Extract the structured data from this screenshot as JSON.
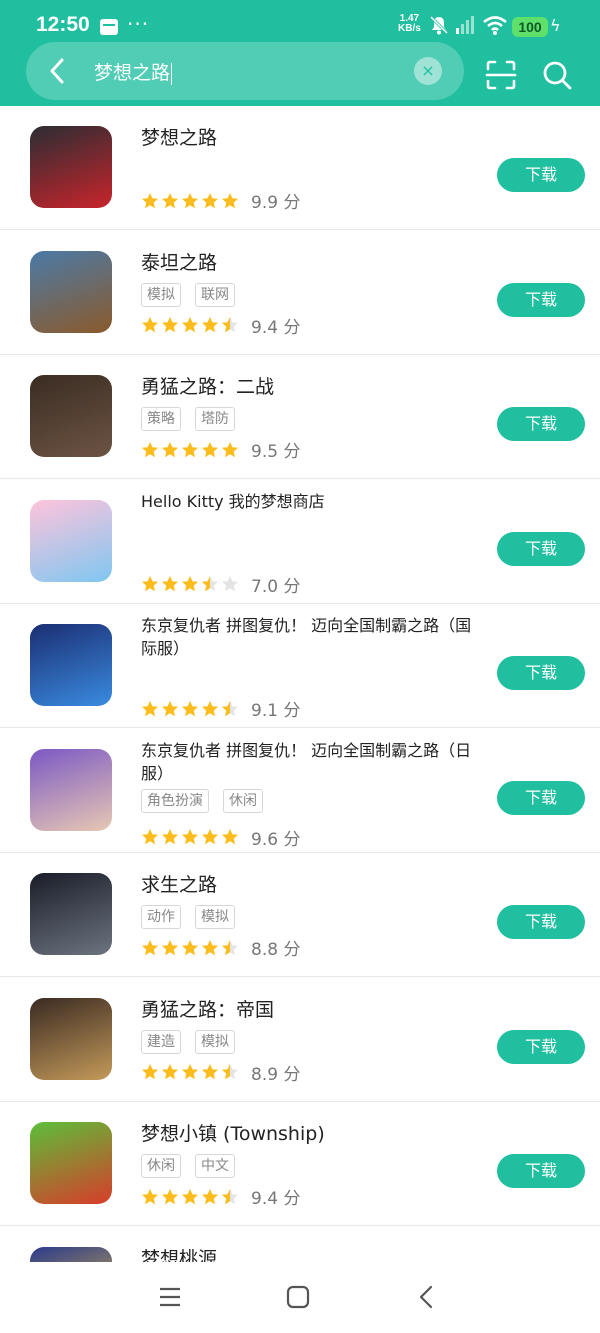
{
  "status_bar": {
    "time": "12:50",
    "dots": "···",
    "net_speed_value": "1.47",
    "net_speed_unit": "KB/s",
    "battery": "100"
  },
  "search": {
    "query": "梦想之路",
    "clear_label": "×"
  },
  "download_label": "下载",
  "score_unit": "分",
  "apps": [
    {
      "title": "梦想之路",
      "tags": [],
      "score": "9.9",
      "stars": 5,
      "icon_name": "dr-racing-icon",
      "icon_colors": [
        "#2a2d33",
        "#c9242b"
      ]
    },
    {
      "title": "泰坦之路",
      "tags": [
        "模拟",
        "联网"
      ],
      "score": "9.4",
      "stars": 4.5,
      "icon_name": "dinosaur-icon",
      "icon_colors": [
        "#4b7aa7",
        "#8b5a2b"
      ]
    },
    {
      "title": "勇猛之路：二战",
      "tags": [
        "策略",
        "塔防"
      ],
      "score": "9.5",
      "stars": 5,
      "icon_name": "soldier-icon",
      "icon_colors": [
        "#3a2c22",
        "#6d5444"
      ]
    },
    {
      "title": "Hello Kitty 我的梦想商店",
      "tags": [],
      "score": "7.0",
      "stars": 3.5,
      "icon_name": "hello-kitty-icon",
      "icon_colors": [
        "#ffc4dc",
        "#7fc6f0"
      ]
    },
    {
      "title": "东京复仇者 拼图复仇！ 迈向全国制霸之路（国际服）",
      "tags": [],
      "score": "9.1",
      "stars": 4.5,
      "icon_name": "tokyo-revengers-icon",
      "icon_colors": [
        "#1b2e72",
        "#3a8be0"
      ]
    },
    {
      "title": "东京复仇者 拼图复仇！ 迈向全国制霸之路（日服）",
      "tags": [
        "角色扮演",
        "休闲"
      ],
      "score": "9.6",
      "stars": 5,
      "icon_name": "tokyo-revengers-jp-icon",
      "icon_colors": [
        "#7b58c4",
        "#e7c8b3"
      ]
    },
    {
      "title": "求生之路",
      "tags": [
        "动作",
        "模拟"
      ],
      "score": "8.8",
      "stars": 4.5,
      "icon_name": "left-to-survive-icon",
      "icon_colors": [
        "#1a1d28",
        "#6c7480"
      ]
    },
    {
      "title": "勇猛之路：帝国",
      "tags": [
        "建造",
        "模拟"
      ],
      "score": "8.9",
      "stars": 4.5,
      "icon_name": "roman-warrior-icon",
      "icon_colors": [
        "#3a2a22",
        "#c49a5a"
      ]
    },
    {
      "title": "梦想小镇 (Township)",
      "tags": [
        "休闲",
        "中文"
      ],
      "score": "9.4",
      "stars": 4.5,
      "icon_name": "township-icon",
      "icon_colors": [
        "#5bbf3a",
        "#d83c2a"
      ]
    },
    {
      "title": "梦想桃源",
      "tags": [],
      "score": "",
      "stars": 0,
      "icon_name": "dream-garden-icon",
      "icon_colors": [
        "#2a3a8a",
        "#f5c542"
      ]
    }
  ],
  "colors": {
    "brand": "#1fbf9f",
    "star": "#fbbd1d",
    "star_empty": "#e4e4e4"
  }
}
